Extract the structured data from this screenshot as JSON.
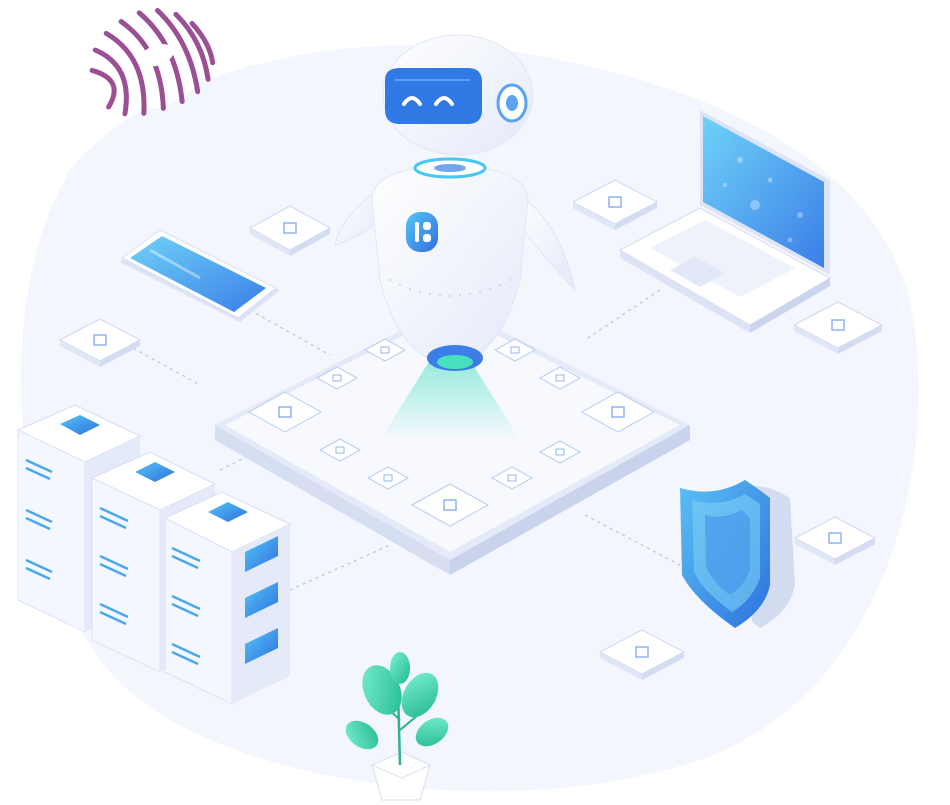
{
  "scene": {
    "robot_icon": "robot-icon",
    "laptop_icon": "laptop-icon",
    "phone_icon": "smartphone-icon",
    "shield_icon": "shield-icon",
    "server_icon": "server-rack-icon",
    "plant_icon": "potted-plant-icon",
    "torus_icon": "striped-torus-icon",
    "chip_icon": "chip-tile-icon"
  },
  "colors": {
    "background_blob": "#f4f6fd",
    "accent_blue": "#3b8cf0",
    "accent_cyan": "#46c8f0",
    "accent_teal": "#3fe0c0",
    "line_gray": "#b9c8ea",
    "torus_purple": "#9b4f95",
    "robot_body": "#ffffff",
    "robot_visor": "#2f7ae5",
    "plant_green": "#3dd6a8"
  }
}
